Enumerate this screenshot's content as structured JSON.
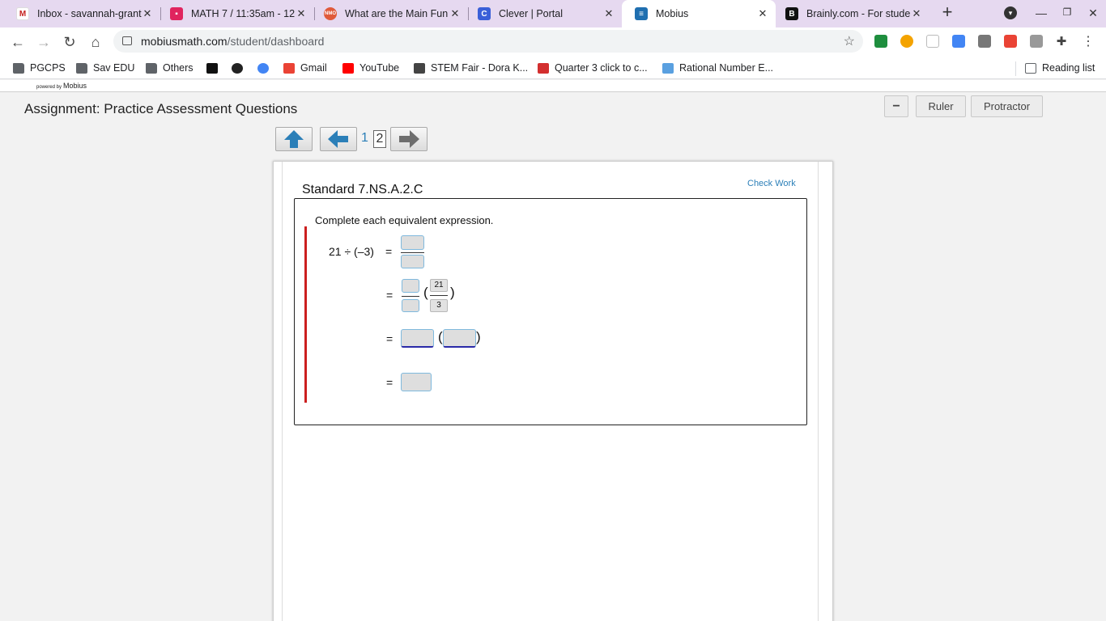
{
  "browser": {
    "tabs": [
      {
        "title": "Inbox - savannah-grant",
        "favicon": "gmail-icon",
        "color": "#c5221f"
      },
      {
        "title": "MATH 7 / 11:35am - 12",
        "favicon": "classroom-icon",
        "color": "#e0245e"
      },
      {
        "title": "What are the Main Fun",
        "favicon": "nmo-icon",
        "color": "#e05a3a"
      },
      {
        "title": "Clever | Portal",
        "favicon": "clever-icon",
        "color": "#3a5fd8"
      },
      {
        "title": "Mobius",
        "favicon": "mobius-icon",
        "color": "#1f6fb0"
      },
      {
        "title": "Brainly.com - For stude",
        "favicon": "brainly-icon",
        "color": "#111111"
      }
    ],
    "new_tab": "+",
    "url_host": "mobiusmath.com",
    "url_path": "/student/dashboard",
    "bookmarks": [
      {
        "label": "PGCPS",
        "icon": "folder-icon"
      },
      {
        "label": "Sav EDU",
        "icon": "folder-icon"
      },
      {
        "label": "Others",
        "icon": "folder-icon"
      },
      {
        "label": "",
        "icon": "flipgrid-icon"
      },
      {
        "label": "",
        "icon": "globe-icon"
      },
      {
        "label": "",
        "icon": "google-icon"
      },
      {
        "label": "Gmail",
        "icon": "gmail-icon"
      },
      {
        "label": "YouTube",
        "icon": "youtube-icon"
      },
      {
        "label": "STEM Fair - Dora K...",
        "icon": "w-icon"
      },
      {
        "label": "Quarter 3 click to c...",
        "icon": "quarter-icon"
      },
      {
        "label": "Rational Number E...",
        "icon": "rational-icon"
      }
    ],
    "reading_list": "Reading list"
  },
  "mobius": {
    "powered_by": "powered by",
    "brand": "Mobius",
    "assignment_title": "Assignment: Practice Assessment Questions",
    "tools": {
      "minus": "−",
      "ruler": "Ruler",
      "protractor": "Protractor"
    },
    "pager": {
      "current": "1",
      "next": "2"
    },
    "standard": "Standard 7.NS.A.2.C",
    "check_work": "Check Work",
    "instruction": "Complete each equivalent expression.",
    "expression": "21 ÷ (–3)",
    "equals": "=",
    "given_numerator": "21",
    "given_denominator": "3",
    "paren_open": "(",
    "paren_close": ")"
  }
}
